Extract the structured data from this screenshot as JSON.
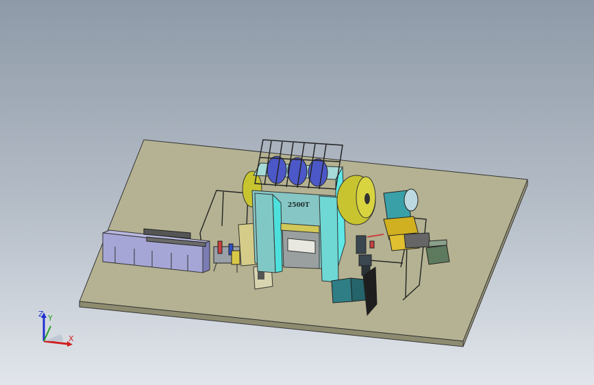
{
  "viewport": {
    "background_top": "#8e9aa8",
    "background_bottom": "#e2e6ec",
    "floor_color": "#b4b292"
  },
  "press": {
    "label": "2500T",
    "body_color": "#86c6c4",
    "accent_color": "#5fe8e6",
    "flywheel_color": "#c8c430",
    "tank_color": "#4c58c8"
  },
  "triad": {
    "x_label": "X",
    "y_label": "Y",
    "z_label": "Z",
    "x_color": "#d02020",
    "y_color": "#20a020",
    "z_color": "#2030d0"
  }
}
